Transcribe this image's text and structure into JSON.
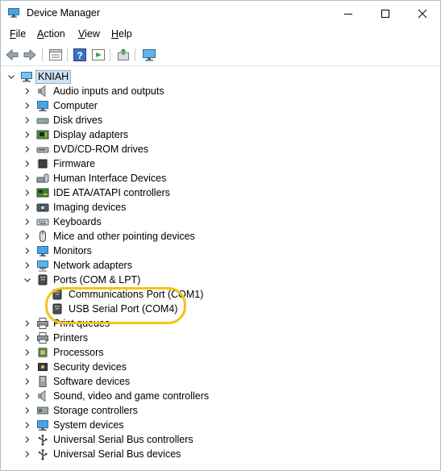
{
  "window": {
    "title": "Device Manager"
  },
  "menu": [
    {
      "label": "File",
      "accel": "F",
      "rest": "ile"
    },
    {
      "label": "Action",
      "accel": "A",
      "rest": "ction"
    },
    {
      "label": "View",
      "accel": "V",
      "rest": "iew"
    },
    {
      "label": "Help",
      "accel": "H",
      "rest": "elp"
    }
  ],
  "tree": {
    "root": "KNIAH",
    "categories": [
      {
        "label": "Audio inputs and outputs",
        "icon": "speaker-icon"
      },
      {
        "label": "Computer",
        "icon": "computer-icon"
      },
      {
        "label": "Disk drives",
        "icon": "disk-drive-icon"
      },
      {
        "label": "Display adapters",
        "icon": "display-adapter-icon"
      },
      {
        "label": "DVD/CD-ROM drives",
        "icon": "dvd-drive-icon"
      },
      {
        "label": "Firmware",
        "icon": "firmware-icon"
      },
      {
        "label": "Human Interface Devices",
        "icon": "hid-icon"
      },
      {
        "label": "IDE ATA/ATAPI controllers",
        "icon": "ide-controller-icon"
      },
      {
        "label": "Imaging devices",
        "icon": "camera-icon"
      },
      {
        "label": "Keyboards",
        "icon": "keyboard-icon"
      },
      {
        "label": "Mice and other pointing devices",
        "icon": "mouse-icon"
      },
      {
        "label": "Monitors",
        "icon": "monitor-icon"
      },
      {
        "label": "Network adapters",
        "icon": "network-adapter-icon"
      },
      {
        "label": "Ports (COM & LPT)",
        "icon": "port-icon",
        "expanded": true
      },
      {
        "label": "Print queues",
        "icon": "printer-icon"
      },
      {
        "label": "Printers",
        "icon": "printer-icon"
      },
      {
        "label": "Processors",
        "icon": "processor-icon"
      },
      {
        "label": "Security devices",
        "icon": "security-icon"
      },
      {
        "label": "Software devices",
        "icon": "software-device-icon"
      },
      {
        "label": "Sound, video and game controllers",
        "icon": "speaker-icon"
      },
      {
        "label": "Storage controllers",
        "icon": "storage-controller-icon"
      },
      {
        "label": "System devices",
        "icon": "system-device-icon"
      },
      {
        "label": "Universal Serial Bus controllers",
        "icon": "usb-icon"
      },
      {
        "label": "Universal Serial Bus devices",
        "icon": "usb-icon"
      }
    ],
    "ports_children": [
      {
        "label": "Communications Port (COM1)",
        "icon": "port-icon"
      },
      {
        "label": "USB Serial Port (COM4)",
        "icon": "port-icon"
      }
    ]
  },
  "colors": {
    "highlight": "#f5c218",
    "selection": "#cce4f7"
  }
}
